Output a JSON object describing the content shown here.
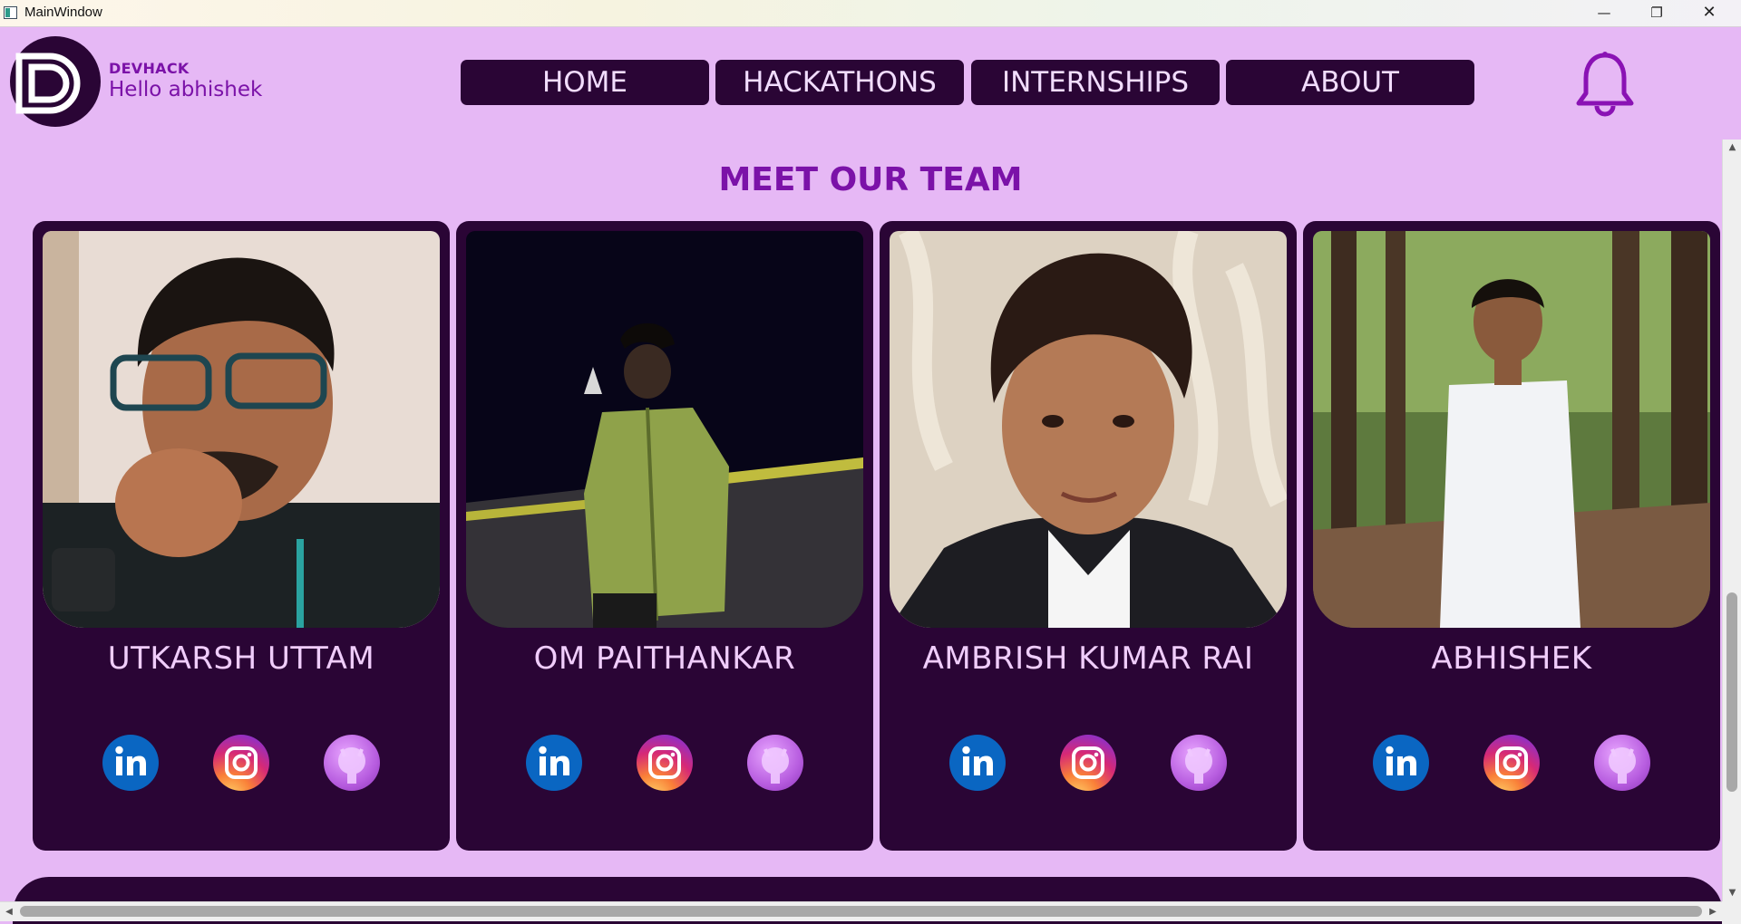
{
  "window": {
    "title": "MainWindow",
    "minimize_icon": "minimize-icon",
    "maximize_icon": "restore-icon",
    "close_icon": "close-icon"
  },
  "header": {
    "brand": "DEVHACK",
    "greeting": "Hello abhishek",
    "logo_icon": "devhack-logo",
    "notification_icon": "bell-icon"
  },
  "nav": {
    "home": "HOME",
    "hackathons": "HACKATHONS",
    "internships": "INTERNSHIPS",
    "about": "ABOUT"
  },
  "team": {
    "title": "MEET OUR TEAM",
    "members": [
      {
        "name": "UTKARSH UTTAM"
      },
      {
        "name": "OM PAITHANKAR"
      },
      {
        "name": "AMBRISH KUMAR RAI"
      },
      {
        "name": "ABHISHEK"
      }
    ],
    "social_icons": [
      "linkedin-icon",
      "instagram-icon",
      "github-icon"
    ]
  },
  "colors": {
    "background": "#e6b8f5",
    "panel": "#2a0535",
    "accent": "#7b12a8",
    "name_text": "#f0cdfb"
  }
}
